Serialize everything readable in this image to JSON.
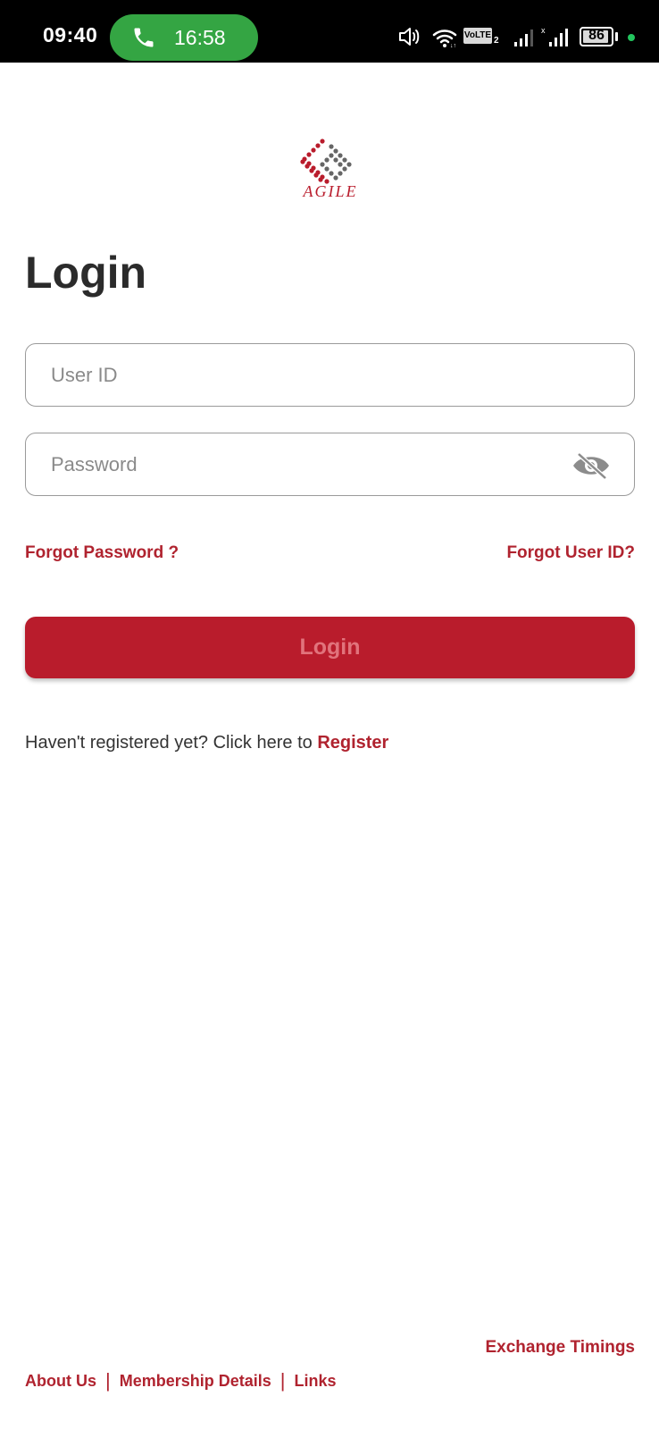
{
  "status_bar": {
    "time": "09:40",
    "call_duration": "16:58",
    "network_label": "VoLTE",
    "network_sim": "2",
    "battery_level": "86",
    "icons": [
      "volume-icon",
      "wifi-icon",
      "volte-icon",
      "signal-icon-sim1",
      "signal-icon-sim2",
      "battery-icon",
      "notification-dot"
    ]
  },
  "brand": {
    "logo_text": "AGILE",
    "accent_color": "#b91c2c",
    "logo_grey": "#666666"
  },
  "page": {
    "title": "Login"
  },
  "form": {
    "user_id": {
      "value": "",
      "placeholder": "User ID"
    },
    "password": {
      "value": "",
      "placeholder": "Password",
      "toggle_icon": "eye-slash-icon"
    },
    "forgot_password": "Forgot Password ?",
    "forgot_user_id": "Forgot User ID?",
    "submit_label": "Login"
  },
  "register": {
    "prompt": "Haven't registered yet? Click here to ",
    "link": "Register"
  },
  "footer": {
    "exchange_timings": "Exchange Timings",
    "links": [
      "About Us",
      "Membership Details",
      "Links"
    ],
    "separator": "|"
  }
}
